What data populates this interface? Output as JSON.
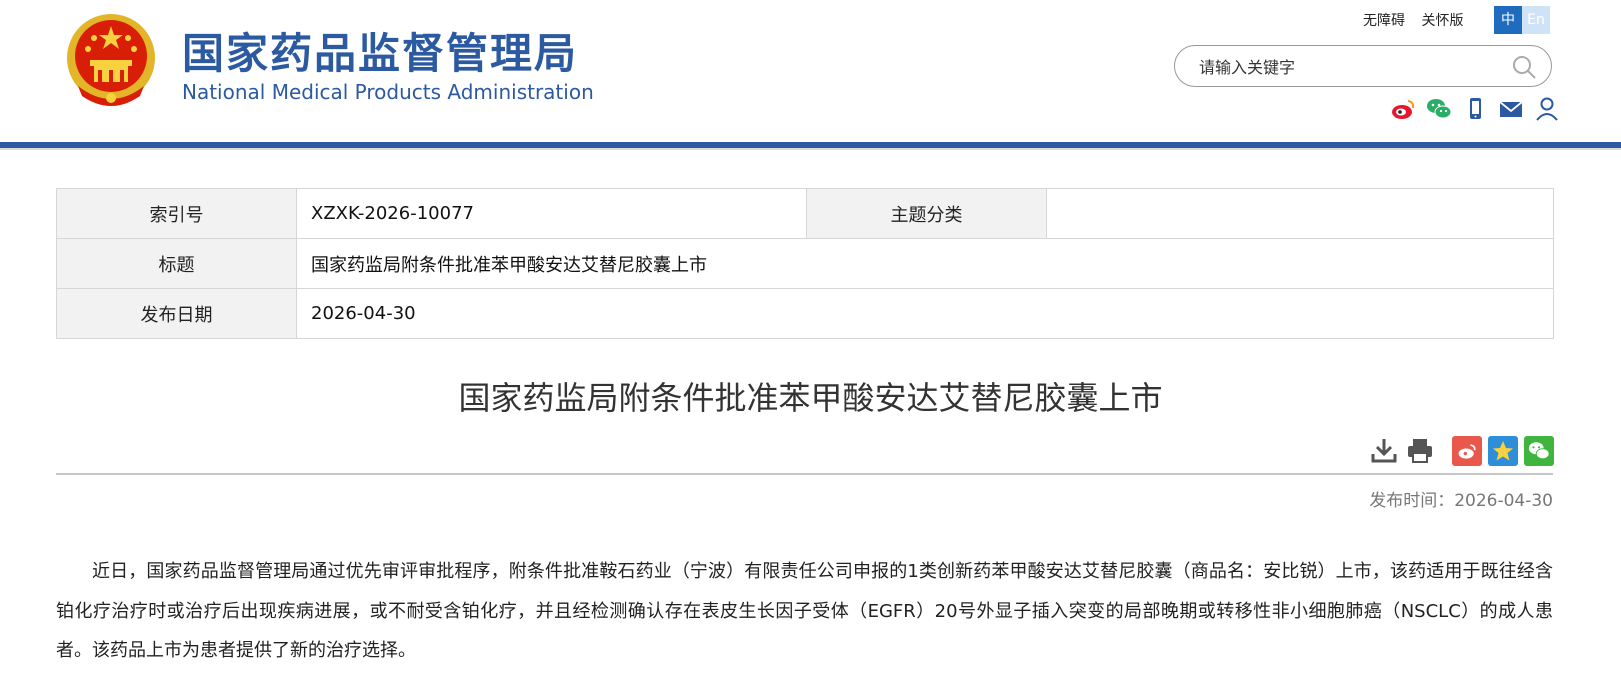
{
  "header": {
    "site_title": "国家药品监督管理局",
    "site_subtitle": "National Medical Products Administration",
    "links": [
      "无障碍",
      "关怀版"
    ],
    "lang_zh": "中",
    "lang_en": "En",
    "search_placeholder": "请输入关键字",
    "social_icons": [
      "weibo-icon",
      "wechat-icon",
      "mobile-icon",
      "mail-icon",
      "user-icon"
    ],
    "brand_color": "#2c5aa0"
  },
  "meta": {
    "index_label": "索引号",
    "index_value": "XZXK-2026-10077",
    "topic_label": "主题分类",
    "topic_value": "",
    "title_label": "标题",
    "title_value": "国家药监局附条件批准苯甲酸安达艾替尼胶囊上市",
    "date_label": "发布日期",
    "date_value": "2026-04-30"
  },
  "article": {
    "title": "国家药监局附条件批准苯甲酸安达艾替尼胶囊上市",
    "publish_time": "发布时间：2026-04-30",
    "paragraph": "近日，国家药品监督管理局通过优先审评审批程序，附条件批准鞍石药业（宁波）有限责任公司申报的1类创新药苯甲酸安达艾替尼胶囊（商品名：安比锐）上市，该药适用于既往经含铂化疗治疗时或治疗后出现疾病进展，或不耐受含铂化疗，并且经检测确认存在表皮生长因子受体（EGFR）20号外显子插入突变的局部晚期或转移性非小细胞肺癌（NSCLC）的成人患者。该药品上市为患者提供了新的治疗选择。"
  }
}
